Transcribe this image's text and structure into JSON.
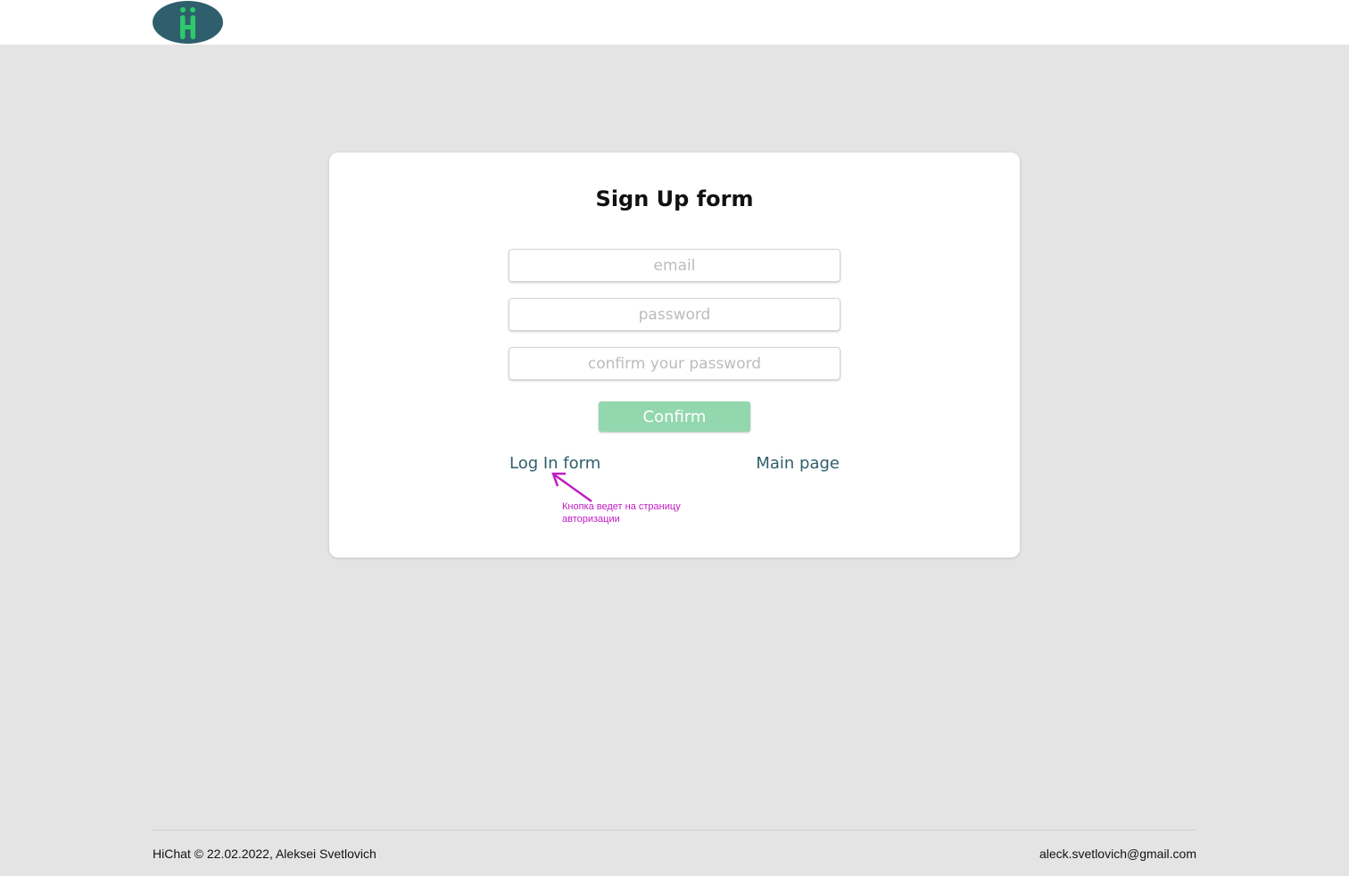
{
  "header": {
    "logo_text": "Hi"
  },
  "form": {
    "title": "Sign Up form",
    "email_placeholder": "email",
    "password_placeholder": "password",
    "confirm_password_placeholder": "confirm your password",
    "confirm_label": "Confirm",
    "login_link": "Log In form",
    "main_page_link": "Main page"
  },
  "annotation": {
    "text": "Кнопка ведет на страницу авторизации",
    "color": "#c21bc2"
  },
  "footer": {
    "copyright": "HiChat © 22.02.2022, Aleksei Svetlovich",
    "email": "aleck.svetlovich@gmail.com"
  },
  "colors": {
    "brand_dark": "#2f5f6c",
    "brand_green": "#2dca6b",
    "button": "#93d7ae"
  }
}
